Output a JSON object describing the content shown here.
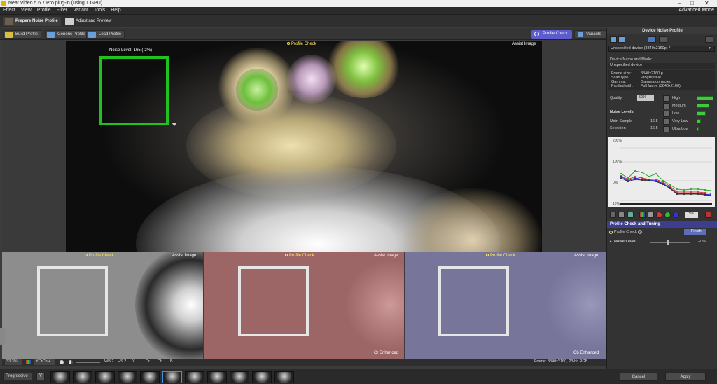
{
  "window": {
    "title": "Neat Video 5.6.7 Pro plug-in (using 1 GPU)",
    "advanced_mode": "Advanced Mode"
  },
  "menu": [
    "Effect",
    "View",
    "Profile",
    "Filter",
    "Variant",
    "Tools",
    "Help"
  ],
  "steps": {
    "prepare": "Prepare Noise Profile",
    "adjust": "Adjust and Preview"
  },
  "toolbar": {
    "build_profile": "Build Profile",
    "generic_profile": "Generic Profile",
    "load_profile": "Load Profile",
    "profile_check": "Profile Check",
    "variants": "Variants"
  },
  "viewer": {
    "noise_level": "Noise Level: 165 (-2%)",
    "profile_check": "Profile Check",
    "assist_image": "Assist Image"
  },
  "panels": [
    {
      "profile_check": "Profile Check",
      "assist_image": "Assist Image",
      "footer": ""
    },
    {
      "profile_check": "Profile Check",
      "assist_image": "Assist Image",
      "footer": "Cr Enhanced"
    },
    {
      "profile_check": "Profile Check",
      "assist_image": "Assist Image",
      "footer": "Cb Enhanced"
    }
  ],
  "bottombar": {
    "zoom": "33.3%",
    "mode": "YCrCb +",
    "channels": [
      "Y",
      "Cr",
      "Cb",
      "B"
    ],
    "wb": "WB 2",
    "hs": "HS 2",
    "frame_info": "Frame: 3840x2160, 23-bit RGB"
  },
  "filmstrip": {
    "mode": "Progressive",
    "count": 11,
    "selected": 5
  },
  "dialog": {
    "cancel": "Cancel",
    "apply": "Apply"
  },
  "right_panel": {
    "title": "Device Noise Profile",
    "device_select": "Unspecified device (3840x2160p) *",
    "device_name_header": "Device Name and Mode:",
    "device_name": "Unspecified device",
    "info": [
      {
        "k": "Frame size:",
        "v": "3840x2160 p"
      },
      {
        "k": "Scan type:",
        "v": "Progressive"
      },
      {
        "k": "Gamma:",
        "v": "Gamma corrected"
      },
      {
        "k": "Profiled with:",
        "v": "Full frame (3840x2160)"
      }
    ],
    "quality_label": "Quality",
    "quality_value": "50%",
    "noise_levels_header": "Noise Levels",
    "main_sample_label": "Main Sample",
    "main_sample_value": "16.5",
    "selection_label": "Selection",
    "selection_value": "16.5",
    "freq_levels": [
      {
        "name": "High",
        "level": 1.0
      },
      {
        "name": "Medium",
        "level": 0.75
      },
      {
        "name": "Low",
        "level": 0.55
      },
      {
        "name": "Very Low",
        "level": 0.25
      },
      {
        "name": "Ultra Low",
        "level": 0.1
      }
    ],
    "graph_labels": [
      "200%",
      "100%",
      "0%",
      "10%"
    ],
    "graph_value": "75%",
    "check_header": "Profile Check and Tuning",
    "profile_check_label": "Profile Check",
    "finish_label": "Finish",
    "noise_level_label": "Noise Level",
    "noise_level_value": "+0%"
  },
  "colors": {
    "accent": "#5c5ccf",
    "green_frame": "#1fc21f",
    "label_yellow": "#ffe85a"
  }
}
